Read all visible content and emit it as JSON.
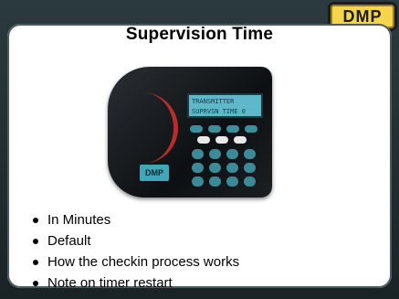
{
  "slide": {
    "title": "Supervision Time",
    "logo_text": "DMP",
    "device": {
      "lcd_line1": "TRANSMITTER",
      "lcd_line2": "SUPRVSN TIME  0",
      "badge_text": "DMP"
    },
    "bullets": [
      "In Minutes",
      "Default",
      "How the checkin process works",
      "Note on timer restart"
    ]
  },
  "colors": {
    "frame_bg": "#1f2a2d",
    "slide_bg": "#ffffff",
    "logo_yellow": "#f4d54b",
    "lcd_blue": "#5fb8c9"
  }
}
